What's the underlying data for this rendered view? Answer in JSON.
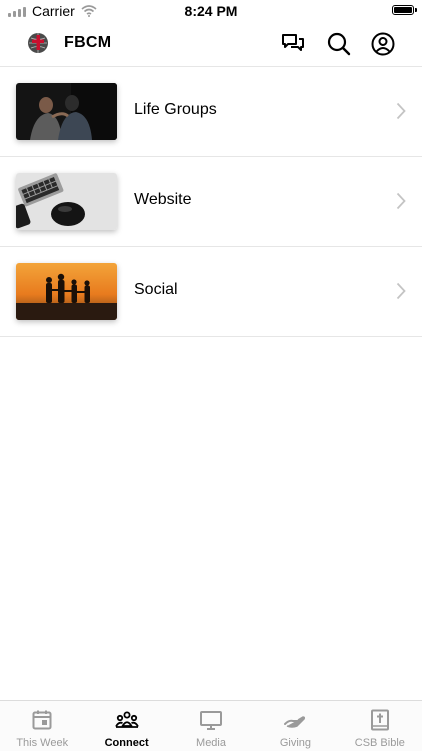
{
  "status_bar": {
    "carrier": "Carrier",
    "time": "8:24 PM"
  },
  "header": {
    "title": "FBCM",
    "icons": [
      "chat-icon",
      "search-icon",
      "account-icon"
    ]
  },
  "list": {
    "items": [
      {
        "label": "Life Groups",
        "image": "two-men-praying"
      },
      {
        "label": "Website",
        "image": "keyboard-and-mouse"
      },
      {
        "label": "Social",
        "image": "sunset-silhouettes"
      }
    ]
  },
  "tabs": {
    "items": [
      {
        "label": "This Week",
        "icon": "calendar-icon",
        "active": false
      },
      {
        "label": "Connect",
        "icon": "people-icon",
        "active": true
      },
      {
        "label": "Media",
        "icon": "monitor-icon",
        "active": false
      },
      {
        "label": "Giving",
        "icon": "giving-hand-icon",
        "active": false
      },
      {
        "label": "CSB Bible",
        "icon": "bible-icon",
        "active": false
      }
    ]
  },
  "colors": {
    "active_tab": "#000000",
    "inactive_tab": "#9a9a9a",
    "divider": "#e6e6e6",
    "logo_red": "#c8102e"
  }
}
